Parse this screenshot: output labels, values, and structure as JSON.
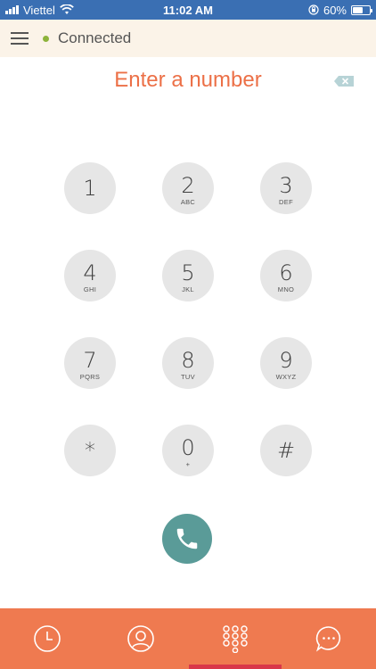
{
  "status_bar": {
    "carrier": "Viettel",
    "time": "11:02 AM",
    "battery": "60%",
    "battery_level": 0.6,
    "icons": [
      "signal-icon",
      "wifi-icon",
      "orientation-lock-icon",
      "battery-icon"
    ]
  },
  "header": {
    "menu_icon": "menu-icon",
    "status": "Connected",
    "status_color": "#8db33a"
  },
  "dialer": {
    "number_placeholder": "Enter a number",
    "backspace_icon": "backspace-icon",
    "keys": [
      {
        "digit": "1",
        "letters": ""
      },
      {
        "digit": "2",
        "letters": "ABC"
      },
      {
        "digit": "3",
        "letters": "DEF"
      },
      {
        "digit": "4",
        "letters": "GHI"
      },
      {
        "digit": "5",
        "letters": "JKL"
      },
      {
        "digit": "6",
        "letters": "MNO"
      },
      {
        "digit": "7",
        "letters": "PQRS"
      },
      {
        "digit": "8",
        "letters": "TUV"
      },
      {
        "digit": "9",
        "letters": "WXYZ"
      },
      {
        "digit": "*",
        "letters": ""
      },
      {
        "digit": "0",
        "letters": "+"
      },
      {
        "digit": "#",
        "letters": ""
      }
    ],
    "call_icon": "phone-icon"
  },
  "tabs": [
    {
      "icon": "clock-icon",
      "name": "tab-recents"
    },
    {
      "icon": "contact-icon",
      "name": "tab-contacts"
    },
    {
      "icon": "dialpad-icon",
      "name": "tab-keypad",
      "active": true
    },
    {
      "icon": "chat-icon",
      "name": "tab-messages"
    }
  ],
  "colors": {
    "status_bar": "#3a6fb3",
    "header_bg": "#fbf3e8",
    "accent": "#ec7047",
    "call": "#5a9b98",
    "tab_bar": "#ef7a50",
    "tab_indicator": "#d9384a"
  }
}
